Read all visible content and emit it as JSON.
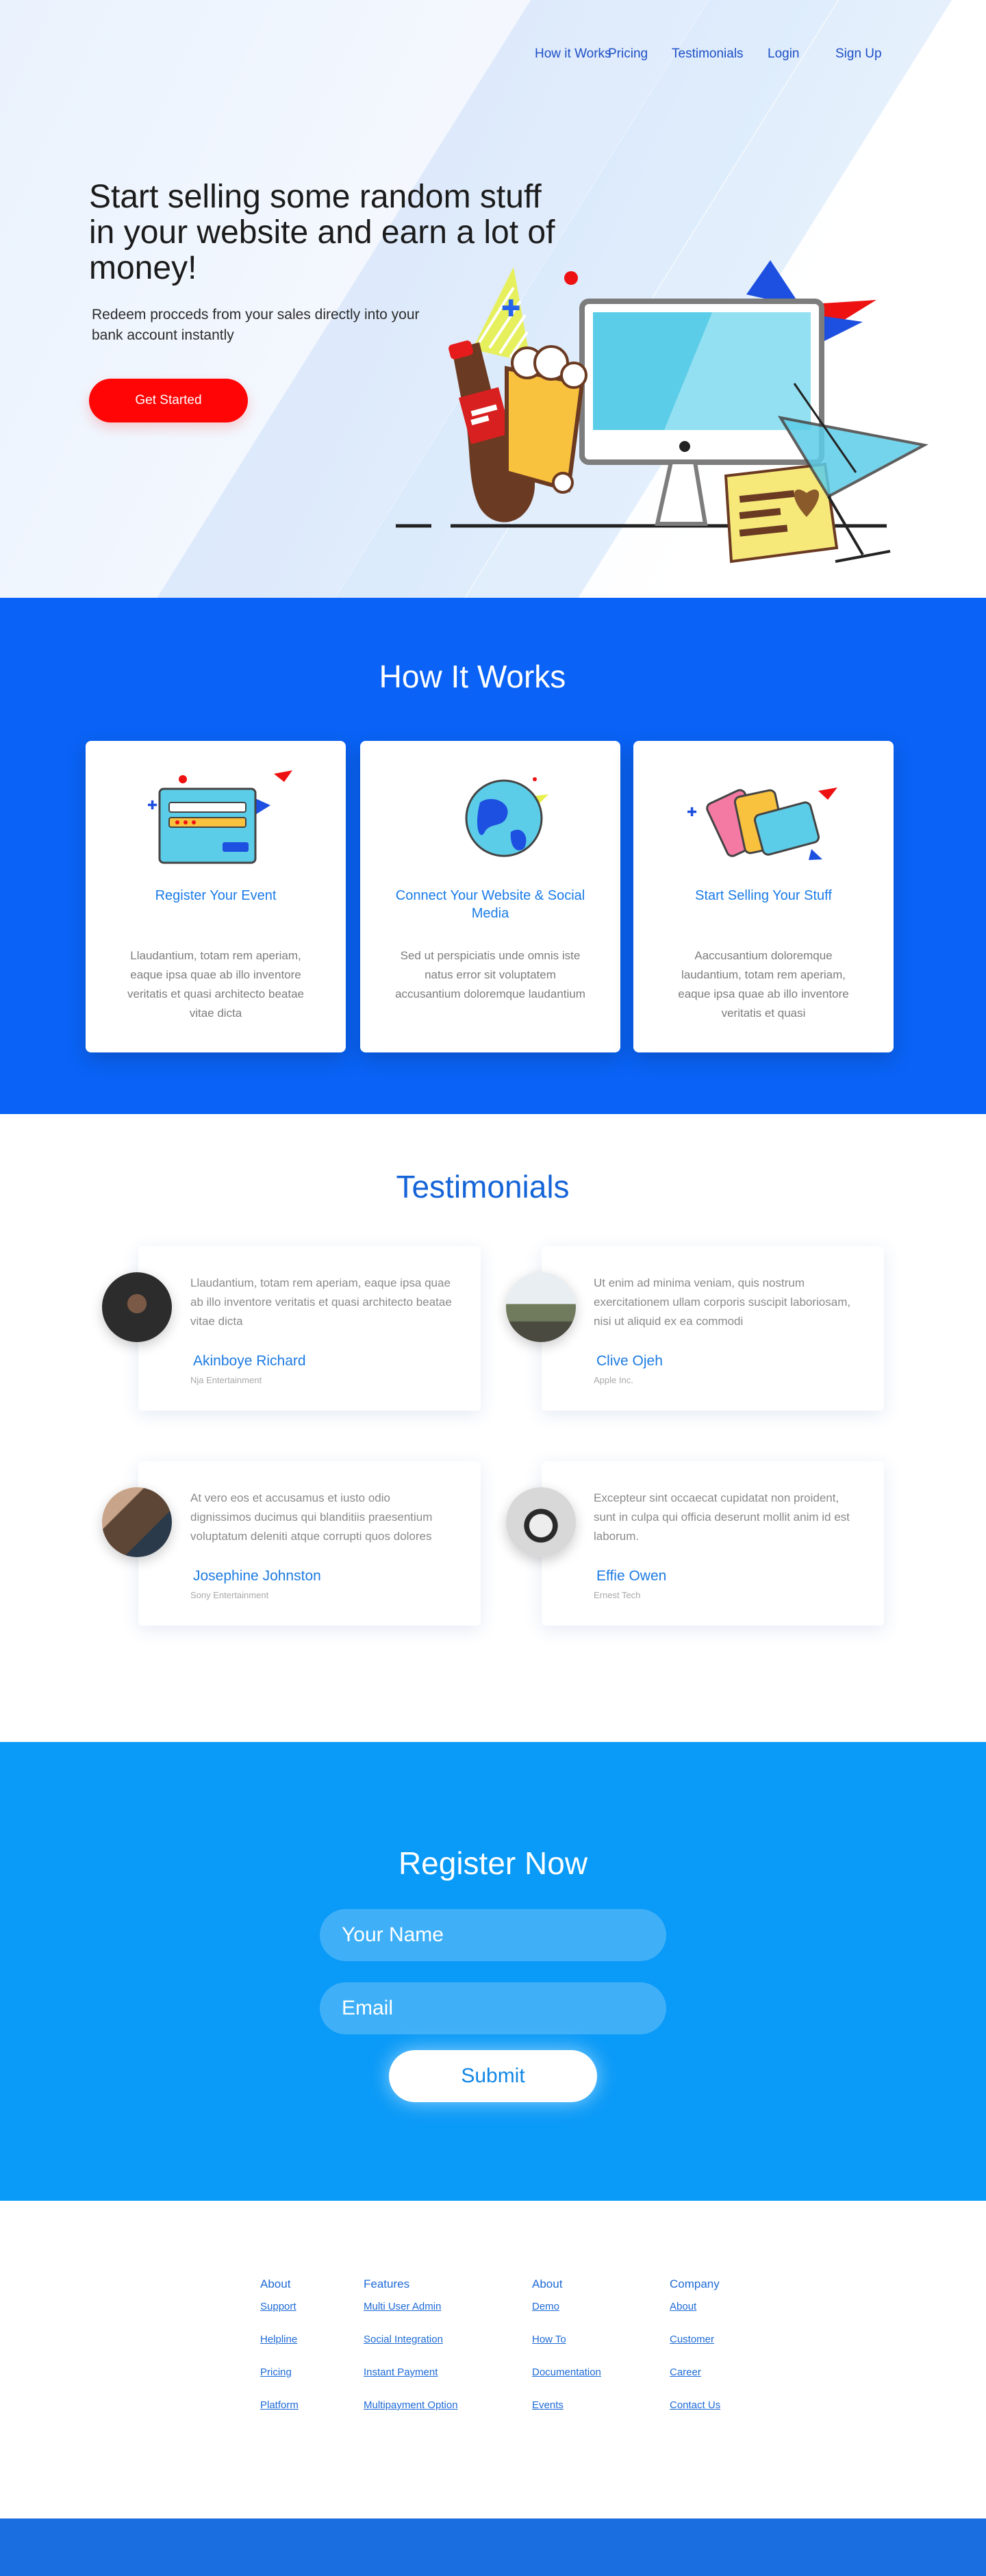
{
  "nav": {
    "items": [
      {
        "label": "How it Works"
      },
      {
        "label": "Pricing"
      },
      {
        "label": "Testimonials"
      },
      {
        "label": "Login"
      },
      {
        "label": "Sign Up"
      }
    ]
  },
  "hero": {
    "title": "Start selling some random stuff in your website and earn a lot of money!",
    "subtitle": "Redeem procceds from your sales directly into your bank account instantly",
    "cta_label": "Get Started"
  },
  "how": {
    "title": "How It Works",
    "cards": [
      {
        "title": "Register Your Event",
        "text": "Llaudantium, totam rem aperiam, eaque ipsa quae ab illo inventore veritatis et quasi architecto beatae vitae dicta",
        "icon": "register-card-icon"
      },
      {
        "title": "Connect Your Website & Social Media",
        "text": "Sed ut perspiciatis unde omnis iste natus error sit voluptatem accusantium doloremque laudantium",
        "icon": "globe-icon"
      },
      {
        "title": "Start Selling Your Stuff",
        "text": "Aaccusantium doloremque laudantium, totam rem aperiam, eaque ipsa quae ab illo inventore veritatis et quasi",
        "icon": "tickets-icon"
      }
    ]
  },
  "testimonials": {
    "title": "Testimonials",
    "items": [
      {
        "quote": "Llaudantium, totam rem aperiam, eaque ipsa quae ab illo inventore veritatis et quasi architecto beatae vitae dicta",
        "name": "Akinboye Richard",
        "company": "Nja Entertainment"
      },
      {
        "quote": "Ut enim ad minima veniam, quis nostrum exercitationem ullam corporis suscipit laboriosam, nisi ut aliquid ex ea commodi",
        "name": "Clive Ojeh",
        "company": "Apple Inc."
      },
      {
        "quote": "At vero eos et accusamus et iusto odio dignissimos ducimus qui blanditiis praesentium voluptatum deleniti atque corrupti quos dolores",
        "name": "Josephine Johnston",
        "company": "Sony Entertainment"
      },
      {
        "quote": "Excepteur sint occaecat cupidatat non proident, sunt in culpa qui officia deserunt mollit anim id est laborum.",
        "name": "Effie Owen",
        "company": "Ernest Tech"
      }
    ]
  },
  "register": {
    "title": "Register Now",
    "name_placeholder": "Your Name",
    "email_placeholder": "Email",
    "submit_label": "Submit"
  },
  "footer": {
    "columns": [
      {
        "heading": "About",
        "links": [
          "Support",
          "Helpline",
          "Pricing",
          "Platform"
        ]
      },
      {
        "heading": "Features",
        "links": [
          "Multi User Admin",
          "Social Integration",
          "Instant Payment",
          "Multipayment Option"
        ]
      },
      {
        "heading": "About",
        "links": [
          "Demo",
          "How To",
          "Documentation",
          "Events"
        ]
      },
      {
        "heading": "Company",
        "links": [
          "About",
          "Customer",
          "Career",
          "Contact Us"
        ]
      }
    ]
  },
  "colors": {
    "primary_blue": "#0a63f6",
    "register_blue": "#0a9af7",
    "cta_red": "#ff0505",
    "link_blue": "#1d6ad6"
  }
}
